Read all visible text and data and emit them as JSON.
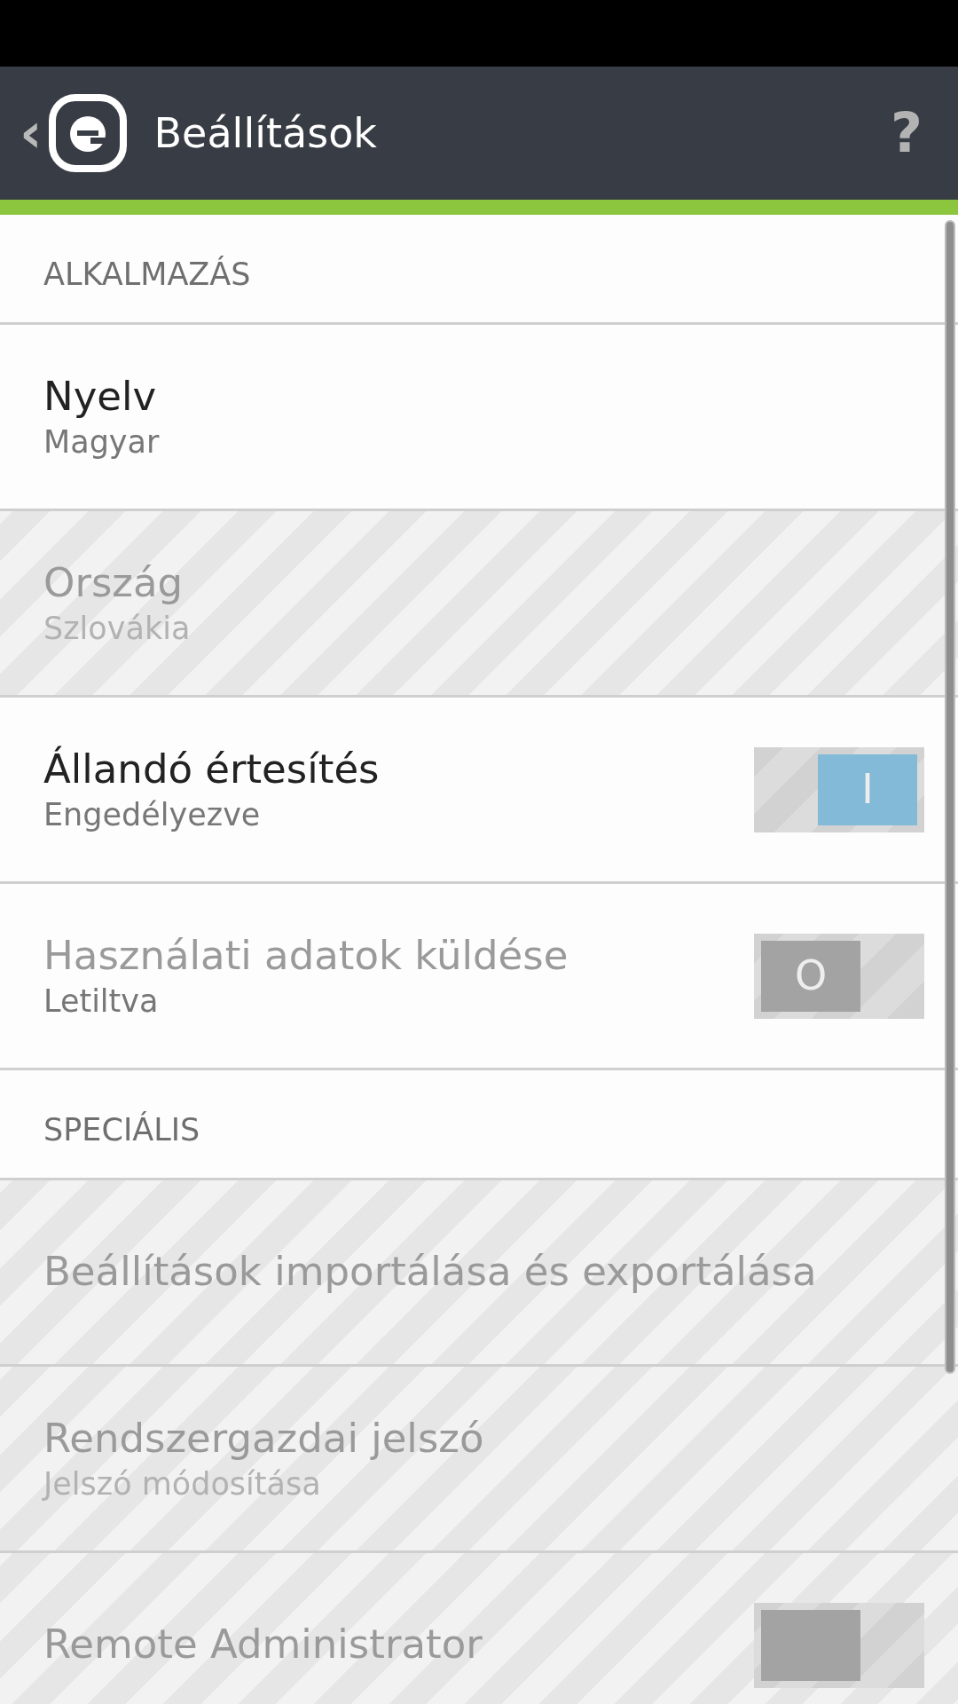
{
  "app_bar": {
    "back": "‹",
    "title": "Beállítások",
    "help": "?"
  },
  "items": [
    {
      "kind": "section",
      "title": "ALKALMAZÁS"
    },
    {
      "kind": "setting",
      "title": "Nyelv",
      "subtitle": "Magyar",
      "disabled": false
    },
    {
      "kind": "setting",
      "title": "Ország",
      "subtitle": "Szlovákia",
      "disabled": true
    },
    {
      "kind": "toggle",
      "title": "Állandó értesítés",
      "subtitle": "Engedélyezve",
      "disabled": false,
      "on": true,
      "toggle_label": "I"
    },
    {
      "kind": "toggle",
      "title": "Használati adatok küldése",
      "subtitle": "Letiltva",
      "disabled": false,
      "on": false,
      "toggle_label": "O"
    },
    {
      "kind": "section",
      "title": "SPECIÁLIS"
    },
    {
      "kind": "setting",
      "title": "Beállítások importálása és exportálása",
      "disabled": true
    },
    {
      "kind": "setting",
      "title": "Rendszergazdai jelszó",
      "subtitle": "Jelszó módosítása",
      "disabled": true
    },
    {
      "kind": "toggle",
      "title": "Remote Administrator",
      "disabled": true,
      "on": false
    }
  ]
}
